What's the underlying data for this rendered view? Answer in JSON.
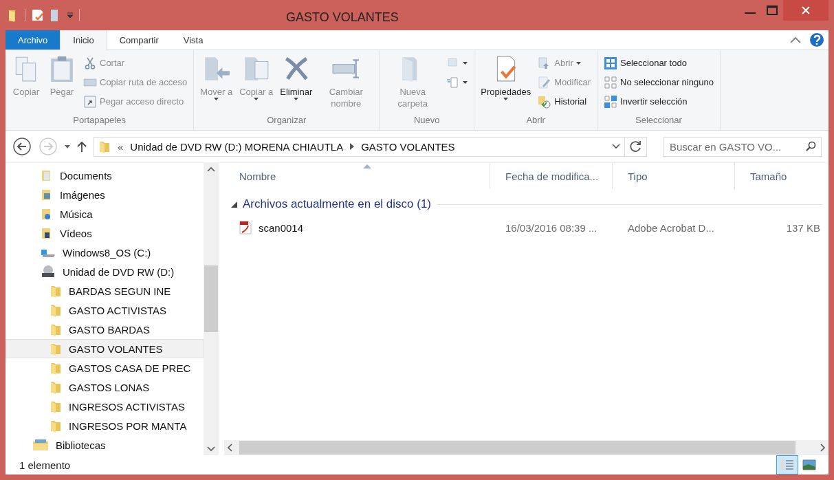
{
  "window": {
    "title": "GASTO VOLANTES"
  },
  "ribbon_tabs": [
    {
      "label": "Archivo",
      "kind": "file",
      "selected": false
    },
    {
      "label": "Inicio",
      "kind": "tab",
      "selected": true
    },
    {
      "label": "Compartir",
      "kind": "tab",
      "selected": false
    },
    {
      "label": "Vista",
      "kind": "tab",
      "selected": false
    }
  ],
  "ribbon_groups": [
    {
      "label": "Portapapeles",
      "items": [
        {
          "kind": "large",
          "label": "Copiar",
          "disabled": true,
          "dropdown": false
        },
        {
          "kind": "large",
          "label": "Pegar",
          "disabled": true,
          "dropdown": false
        },
        {
          "kind": "small",
          "label": "Cortar",
          "disabled": true,
          "dropdown": false
        },
        {
          "kind": "small",
          "label": "Copiar ruta de acceso",
          "disabled": true,
          "dropdown": false
        },
        {
          "kind": "small",
          "label": "Pegar acceso directo",
          "disabled": true,
          "dropdown": false
        }
      ]
    },
    {
      "label": "Organizar",
      "items": [
        {
          "kind": "large",
          "label": "Mover a",
          "disabled": true,
          "dropdown": true
        },
        {
          "kind": "large",
          "label": "Copiar a",
          "disabled": true,
          "dropdown": true
        },
        {
          "kind": "large",
          "label": "Eliminar",
          "disabled": false,
          "dropdown": true
        },
        {
          "kind": "large",
          "label": "Cambiar nombre",
          "disabled": true,
          "dropdown": false
        }
      ]
    },
    {
      "label": "Nuevo",
      "items": [
        {
          "kind": "large",
          "label": "Nueva carpeta",
          "disabled": true,
          "dropdown": false
        },
        {
          "kind": "small",
          "disabled": true,
          "dropdown": true
        },
        {
          "kind": "small",
          "disabled": false,
          "dropdown": true
        }
      ]
    },
    {
      "label": "Abrir",
      "items": [
        {
          "kind": "large",
          "label": "Propiedades",
          "disabled": false,
          "dropdown": true
        },
        {
          "kind": "small",
          "label": "Abrir",
          "disabled": true,
          "dropdown": true
        },
        {
          "kind": "small",
          "label": "Modificar",
          "disabled": true,
          "dropdown": false
        },
        {
          "kind": "small",
          "label": "Historial",
          "disabled": false,
          "dropdown": false
        }
      ]
    },
    {
      "label": "Seleccionar",
      "items": [
        {
          "kind": "small",
          "label": "Seleccionar todo",
          "disabled": false,
          "dropdown": false
        },
        {
          "kind": "small",
          "label": "No seleccionar ninguno",
          "disabled": false,
          "dropdown": false
        },
        {
          "kind": "small",
          "label": "Invertir selección",
          "disabled": false,
          "dropdown": false
        }
      ]
    }
  ],
  "address": {
    "overflow": "«",
    "segments": [
      "Unidad de DVD RW (D:) MORENA CHIAUTLA",
      "GASTO VOLANTES"
    ]
  },
  "search": {
    "placeholder": "Buscar en GASTO VO..."
  },
  "nav_tree": [
    {
      "children": [
        {
          "label": "Documents",
          "kind": "documents",
          "selected": false
        },
        {
          "label": "Imágenes",
          "kind": "pictures",
          "selected": false
        },
        {
          "label": "Música",
          "kind": "music",
          "selected": false
        },
        {
          "label": "Vídeos",
          "kind": "videos",
          "selected": false
        },
        {
          "label": "Windows8_OS (C:)",
          "kind": "drive",
          "selected": false
        },
        {
          "label": "Unidad de DVD RW (D:)",
          "kind": "dvd",
          "selected": false,
          "children": [
            {
              "label": "BARDAS SEGUN INE",
              "kind": "folder",
              "selected": false
            },
            {
              "label": "GASTO ACTIVISTAS",
              "kind": "folder",
              "selected": false
            },
            {
              "label": "GASTO BARDAS",
              "kind": "folder",
              "selected": false
            },
            {
              "label": "GASTO VOLANTES",
              "kind": "folder",
              "selected": true
            },
            {
              "label": "GASTOS CASA DE PREC",
              "kind": "folder",
              "selected": false
            },
            {
              "label": "GASTOS LONAS",
              "kind": "folder",
              "selected": false
            },
            {
              "label": "INGRESOS ACTIVISTAS",
              "kind": "folder",
              "selected": false
            },
            {
              "label": "INGRESOS POR MANTA",
              "kind": "folder",
              "selected": false
            }
          ]
        }
      ]
    },
    {
      "label": "Bibliotecas",
      "kind": "libraries",
      "selected": false
    }
  ],
  "columns": [
    "Nombre",
    "Fecha de modifica...",
    "Tipo",
    "Tamaño"
  ],
  "groups": [
    {
      "label": "Archivos actualmente en el disco (1)",
      "expanded": true,
      "rows": [
        {
          "name": "scan0014",
          "date": "16/03/2016 08:39 ...",
          "type": "Adobe Acrobat D...",
          "size": "137 KB"
        }
      ]
    }
  ],
  "status_bar": {
    "text": "1 elemento"
  },
  "views": [
    {
      "kind": "details",
      "selected": true
    },
    {
      "kind": "thumbnails",
      "selected": false
    }
  ]
}
